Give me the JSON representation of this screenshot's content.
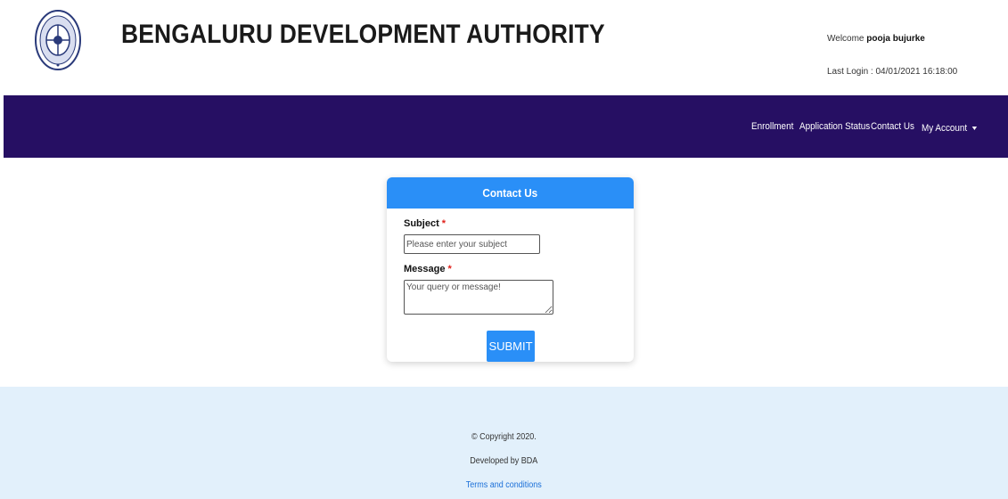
{
  "header": {
    "title": "BENGALURU DEVELOPMENT AUTHORITY",
    "welcome_prefix": "Welcome",
    "username": "pooja bujurke",
    "last_login": "Last Login : 04/01/2021 16:18:00"
  },
  "nav": {
    "items": [
      "Enrollment",
      "Application Status",
      "Contact Us"
    ],
    "account_label": "My Account"
  },
  "contact_form": {
    "title": "Contact Us",
    "subject_label": "Subject",
    "subject_placeholder": "Please enter your subject",
    "message_label": "Message",
    "message_placeholder": "Your query or message!",
    "required_mark": "*",
    "submit_label": "SUBMIT"
  },
  "footer": {
    "copyright": "© Copyright 2020.",
    "developed_by": "Developed by BDA",
    "terms_link": "Terms and conditions"
  },
  "colors": {
    "navbar": "#260f63",
    "accent": "#2a8ff7",
    "footer_bg": "#e2f0fb"
  }
}
